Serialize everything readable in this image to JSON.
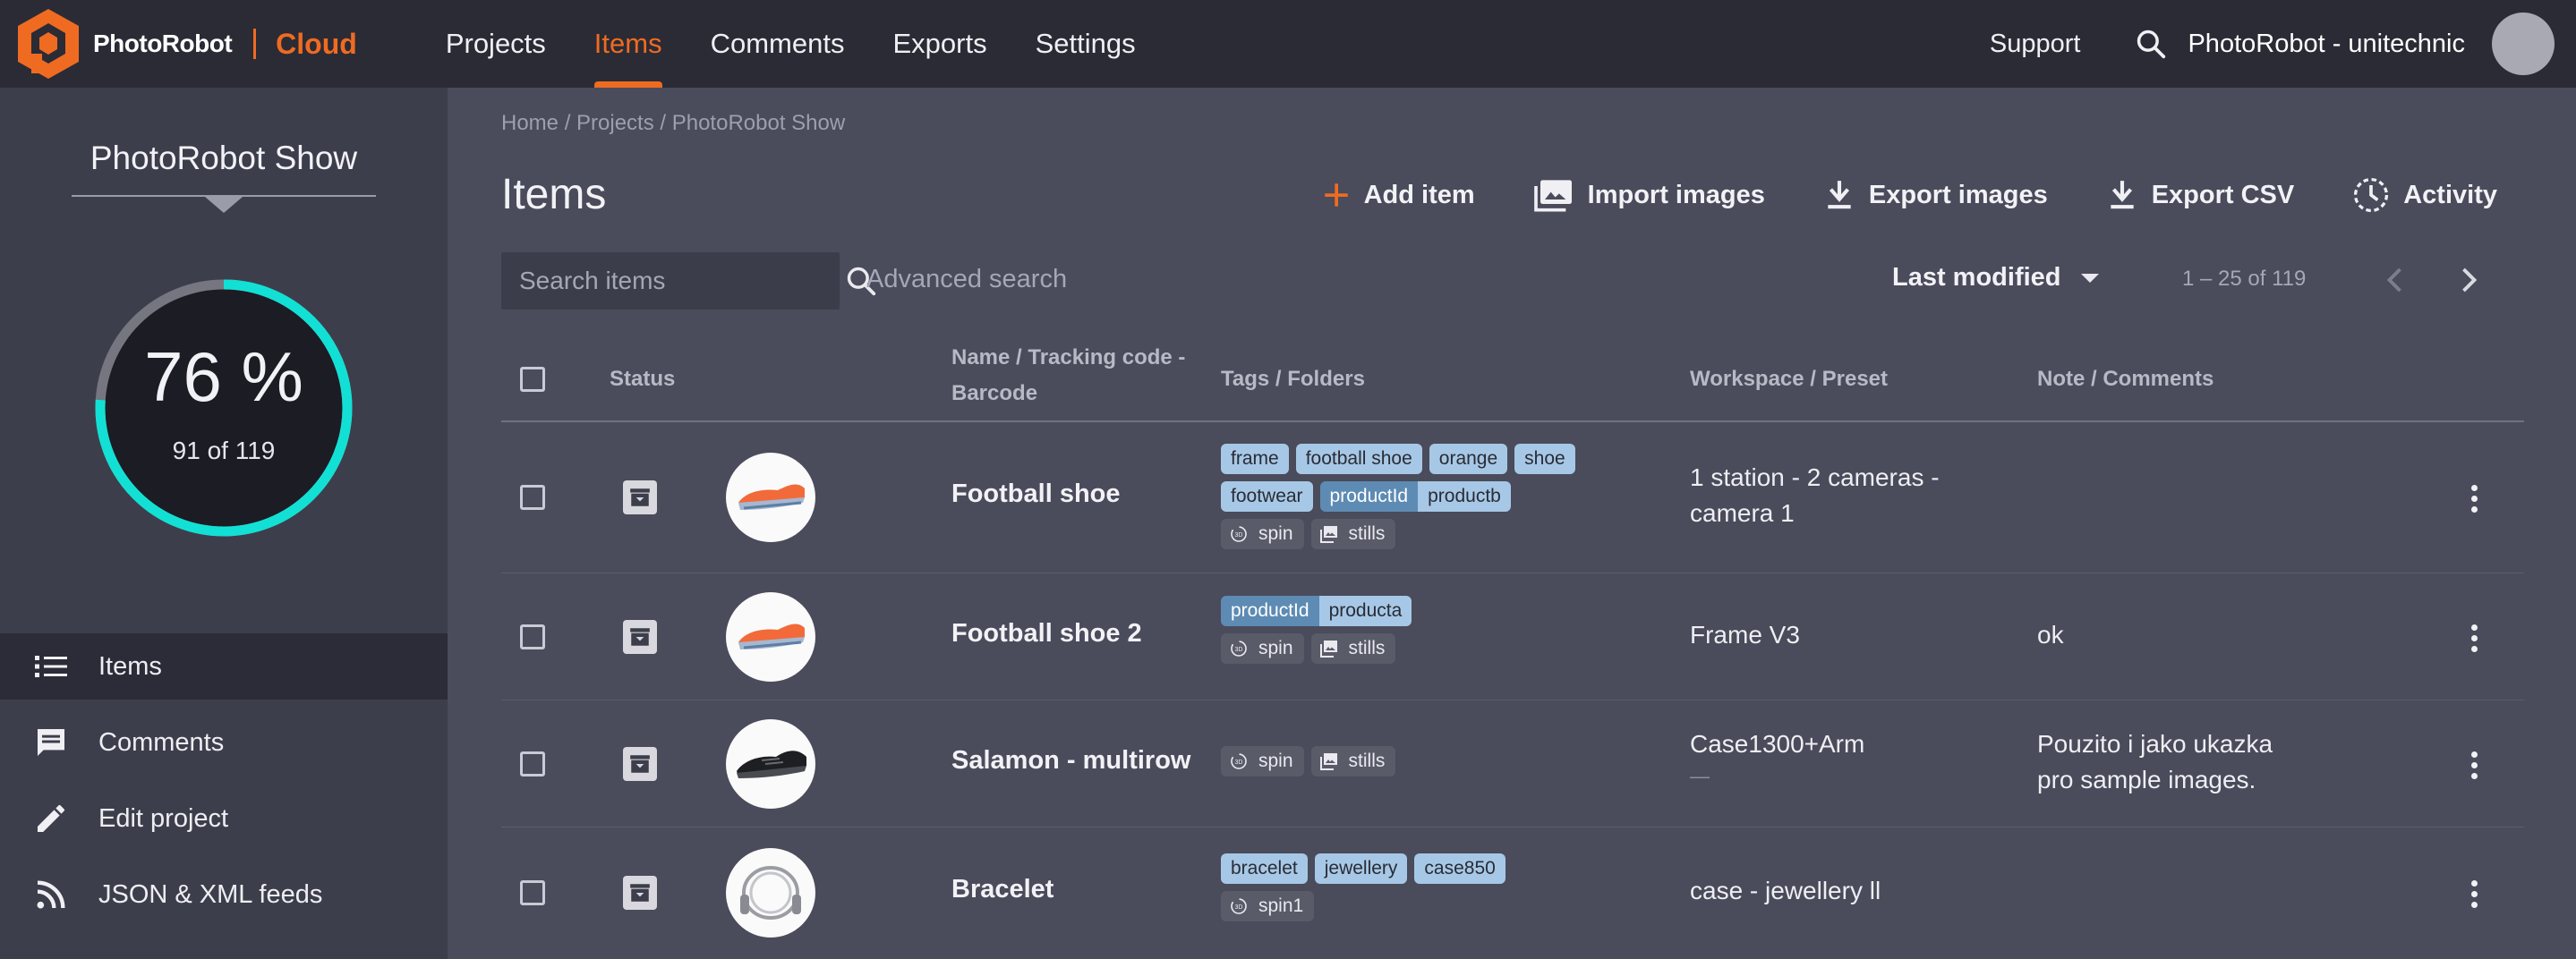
{
  "brand": {
    "name": "PhotoRobot",
    "product": "Cloud",
    "accent": "#ef6b21"
  },
  "nav": {
    "items": [
      {
        "label": "Projects",
        "active": false
      },
      {
        "label": "Items",
        "active": true
      },
      {
        "label": "Comments",
        "active": false
      },
      {
        "label": "Exports",
        "active": false
      },
      {
        "label": "Settings",
        "active": false
      }
    ],
    "support": "Support",
    "account": "PhotoRobot - unitechnic"
  },
  "sidebar": {
    "project_title": "PhotoRobot Show",
    "progress": {
      "percent_label": "76 %",
      "count_label": "91 of 119",
      "value": 0.76,
      "color": "#13e0d4"
    },
    "menu": [
      {
        "label": "Items",
        "icon": "list-icon",
        "active": true
      },
      {
        "label": "Comments",
        "icon": "comment-icon",
        "active": false
      },
      {
        "label": "Edit project",
        "icon": "pencil-icon",
        "active": false
      },
      {
        "label": "JSON & XML feeds",
        "icon": "rss-icon",
        "active": false
      }
    ]
  },
  "main": {
    "breadcrumb": "Home / Projects / PhotoRobot Show",
    "title": "Items",
    "actions": {
      "add": "Add item",
      "import": "Import images",
      "export_images": "Export images",
      "export_csv": "Export CSV",
      "activity": "Activity"
    },
    "search": {
      "placeholder": "Search items",
      "advanced": "Advanced search"
    },
    "sort": "Last modified",
    "pager": "1 – 25 of 119"
  },
  "table": {
    "headers": {
      "status": "Status",
      "name_line1": "Name / Tracking code -",
      "name_line2": "Barcode",
      "tags": "Tags / Folders",
      "workspace": "Workspace / Preset",
      "note": "Note / Comments"
    },
    "rows": [
      {
        "name": "Football shoe",
        "tags": [
          "frame",
          "football shoe",
          "orange",
          "shoe",
          "footwear"
        ],
        "pair": [
          "productId",
          "productb"
        ],
        "folders": [
          "spin",
          "stills"
        ],
        "workspace_line1": "1 station - 2 cameras -",
        "workspace_line2": "camera 1",
        "note_line1": "",
        "note_line2": ""
      },
      {
        "name": "Football shoe 2",
        "pair": [
          "productId",
          "producta"
        ],
        "folders": [
          "spin",
          "stills"
        ],
        "workspace_line1": "Frame V3",
        "note_line1": "ok"
      },
      {
        "name": "Salamon - multirow",
        "folders": [
          "spin",
          "stills"
        ],
        "workspace_line1": "Case1300+Arm",
        "workspace_line2": "—",
        "note_line1": "Pouzito i jako ukazka",
        "note_line2": "pro sample images."
      },
      {
        "name": "Bracelet",
        "tags": [
          "bracelet",
          "jewellery",
          "case850"
        ],
        "folders": [
          "spin1"
        ],
        "workspace_line1": "case - jewellery ll"
      }
    ]
  }
}
